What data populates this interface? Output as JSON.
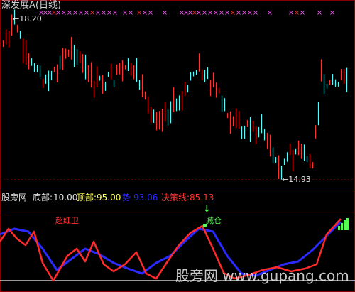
{
  "main_panel": {
    "title": "深发展A(日线)",
    "max_label": "18.20",
    "min_label": "14.93",
    "marker_glyph": "×",
    "colors": {
      "up": "#ff3232",
      "down": "#54fcfc",
      "marker_pink": "#ff5cff",
      "marker_red": "#ff2a2a",
      "title": "#cfcfcf"
    }
  },
  "indicator_panel": {
    "name": "股旁网",
    "params": [
      {
        "label": "底部:",
        "value": "10.00",
        "color": "#e0e0e0"
      },
      {
        "label": "顶部:",
        "value": "95.00",
        "color": "#ffff54"
      },
      {
        "label": "势",
        "value": "93.06",
        "color": "#2a2aff"
      },
      {
        "label": "决策线:",
        "value": "85.13",
        "color": "#ff3232"
      }
    ],
    "annotations": {
      "left": "超红卫",
      "right": "减仓"
    },
    "watermark": "股旁网 www.gupang.com"
  }
}
